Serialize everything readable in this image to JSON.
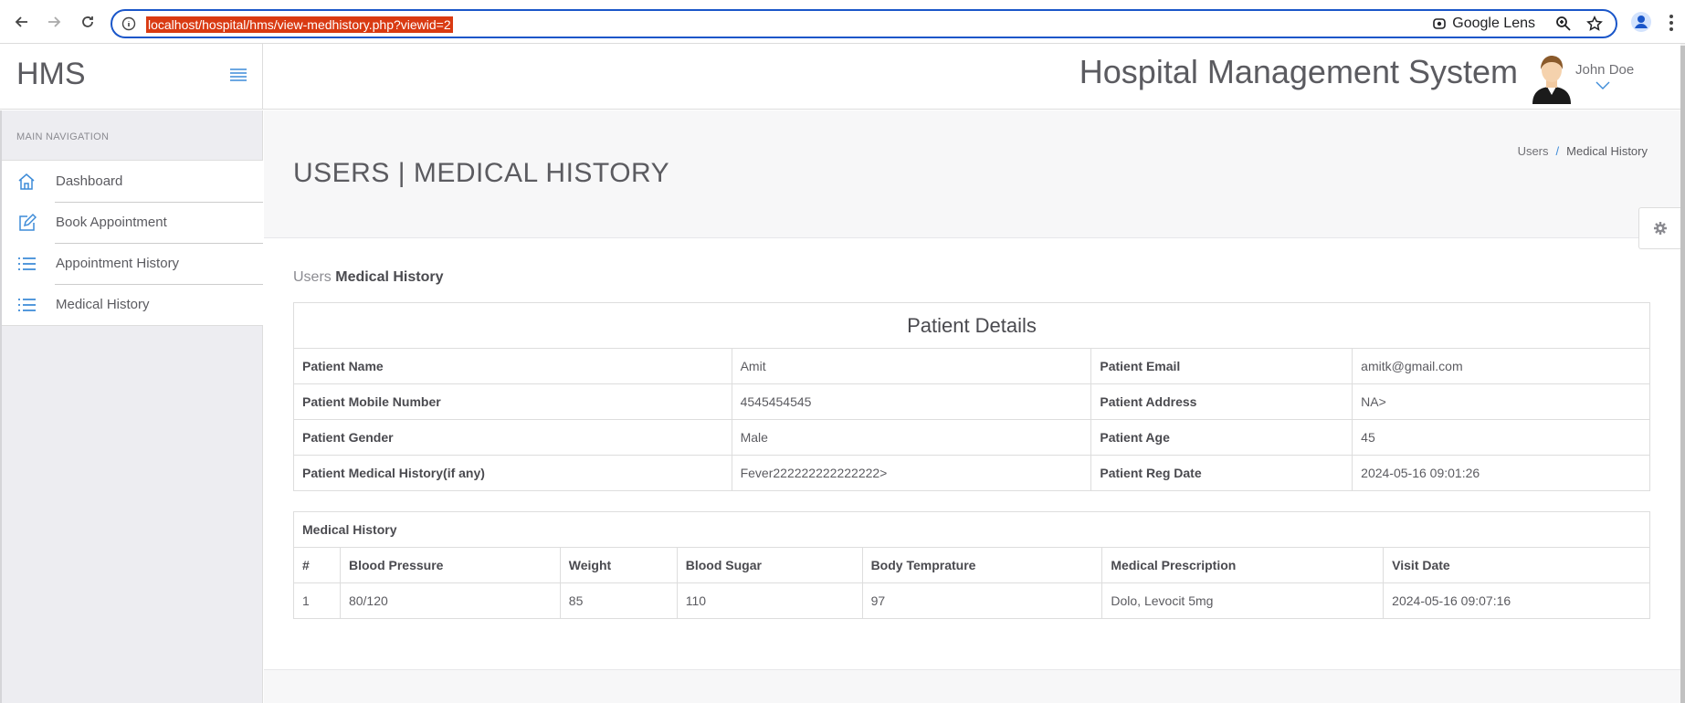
{
  "browser": {
    "url": "localhost/hospital/hms/view-medhistory.php?viewid=2",
    "lens_label": "Google Lens"
  },
  "header": {
    "brand": "HMS",
    "system_title": "Hospital Management System",
    "user_name": "John Doe"
  },
  "sidebar": {
    "heading": "MAIN NAVIGATION",
    "items": [
      {
        "label": "Dashboard",
        "icon": "home-icon"
      },
      {
        "label": "Book Appointment",
        "icon": "edit-icon"
      },
      {
        "label": "Appointment History",
        "icon": "list-icon"
      },
      {
        "label": "Medical History",
        "icon": "list-icon"
      }
    ]
  },
  "page": {
    "title": "USERS | MEDICAL HISTORY",
    "breadcrumb": [
      "Users",
      "Medical History"
    ],
    "section_prefix": "Users",
    "section_title": "Medical History"
  },
  "patient_details": {
    "caption": "Patient Details",
    "rows": [
      [
        "Patient Name",
        "Amit",
        "Patient Email",
        "amitk@gmail.com"
      ],
      [
        "Patient Mobile Number",
        "4545454545",
        "Patient Address",
        "NA>"
      ],
      [
        "Patient Gender",
        "Male",
        "Patient Age",
        "45"
      ],
      [
        "Patient Medical History(if any)",
        "Fever222222222222222>",
        "Patient Reg Date",
        "2024-05-16 09:01:26"
      ]
    ]
  },
  "medical_history": {
    "caption": "Medical History",
    "columns": [
      "#",
      "Blood Pressure",
      "Weight",
      "Blood Sugar",
      "Body Temprature",
      "Medical Prescription",
      "Visit Date"
    ],
    "rows": [
      [
        "1",
        "80/120",
        "85",
        "110",
        "97",
        "Dolo, Levocit 5mg",
        "2024-05-16 09:07:16"
      ]
    ]
  },
  "colors": {
    "accent": "#3d8bd8",
    "url_highlight": "#d93a12",
    "address_border": "#1a56c9"
  }
}
